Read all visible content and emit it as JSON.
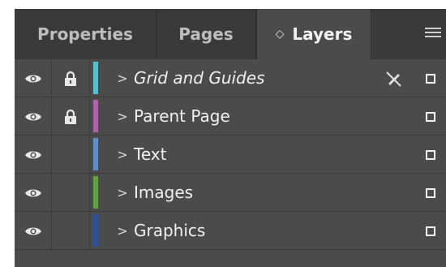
{
  "tabs": [
    {
      "label": "Properties",
      "active": false
    },
    {
      "label": "Pages",
      "active": false
    },
    {
      "label": "Layers",
      "active": true
    }
  ],
  "layers": [
    {
      "name": "Grid and Guides",
      "italic": true,
      "color": "#4ec3d1",
      "visible": true,
      "locked": true,
      "guides_hidden_icon": true
    },
    {
      "name": "Parent Page",
      "italic": false,
      "color": "#b25fb0",
      "visible": true,
      "locked": true,
      "guides_hidden_icon": false
    },
    {
      "name": "Text",
      "italic": false,
      "color": "#5a8fd6",
      "visible": true,
      "locked": false,
      "guides_hidden_icon": false
    },
    {
      "name": "Images",
      "italic": false,
      "color": "#5aa83a",
      "visible": true,
      "locked": false,
      "guides_hidden_icon": false
    },
    {
      "name": "Graphics",
      "italic": false,
      "color": "#2c4fa6",
      "visible": true,
      "locked": false,
      "guides_hidden_icon": false
    }
  ],
  "colors": {
    "panel_bg": "#4b4b4b",
    "tabbar_bg": "#3a3a3a",
    "text": "#f0f0f0",
    "inactive_tab_text": "#bdbdbd"
  }
}
